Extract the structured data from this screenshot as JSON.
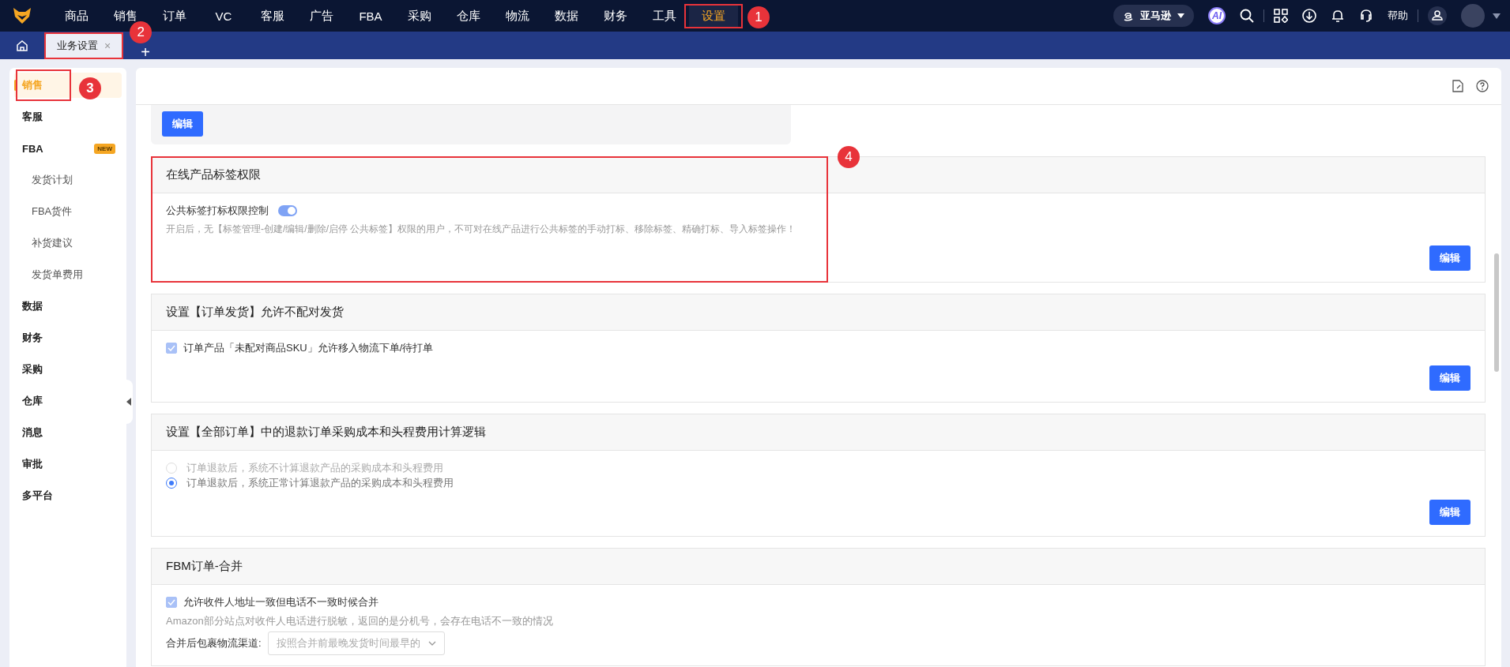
{
  "nav": {
    "items": [
      {
        "label": "商品",
        "selected": false
      },
      {
        "label": "销售",
        "selected": false
      },
      {
        "label": "订单",
        "selected": false
      },
      {
        "label": "VC",
        "selected": false
      },
      {
        "label": "客服",
        "selected": false
      },
      {
        "label": "广告",
        "selected": false
      },
      {
        "label": "FBA",
        "selected": false
      },
      {
        "label": "采购",
        "selected": false
      },
      {
        "label": "仓库",
        "selected": false
      },
      {
        "label": "物流",
        "selected": false
      },
      {
        "label": "数据",
        "selected": false
      },
      {
        "label": "财务",
        "selected": false
      },
      {
        "label": "工具",
        "selected": false
      },
      {
        "label": "设置",
        "selected": true,
        "marker": "1"
      }
    ],
    "marketplace": "亚马逊",
    "ai": "AI",
    "help": "帮助"
  },
  "tabs": {
    "items": [
      {
        "label": "业务设置",
        "close": "×",
        "selected": true,
        "marker": "2"
      }
    ],
    "add": "+"
  },
  "sidebar": {
    "items": [
      {
        "label": "销售",
        "selected": true,
        "marker": "3"
      },
      {
        "label": "客服",
        "selected": false
      },
      {
        "label": "FBA",
        "selected": false,
        "badge": "NEW",
        "children": [
          {
            "label": "发货计划",
            "selected": false
          },
          {
            "label": "FBA货件",
            "selected": false
          },
          {
            "label": "补货建议",
            "selected": false
          },
          {
            "label": "发货单费用",
            "selected": false
          }
        ]
      },
      {
        "label": "数据",
        "selected": false
      },
      {
        "label": "财务",
        "selected": false
      },
      {
        "label": "采购",
        "selected": false
      },
      {
        "label": "仓库",
        "selected": false
      },
      {
        "label": "消息",
        "selected": false
      },
      {
        "label": "审批",
        "selected": false
      },
      {
        "label": "多平台",
        "selected": false
      }
    ]
  },
  "content": {
    "top_button": "编辑",
    "sections": [
      {
        "kind": "toggle",
        "title": "在线产品标签权限",
        "marker": "4",
        "label": "公共标签打标权限控制",
        "on": true,
        "description": "开启后，无【标签管理-创建/编辑/删除/启停 公共标签】权限的用户，不可对在线产品进行公共标签的手动打标、移除标签、精确打标、导入标签操作！",
        "button": "编辑"
      },
      {
        "kind": "checkbox",
        "title": "设置【订单发货】允许不配对发货",
        "label": "订单产品「未配对商品SKU」允许移入物流下单/待打单",
        "checked": true,
        "button": "编辑"
      },
      {
        "kind": "radio",
        "title": "设置【全部订单】中的退款订单采购成本和头程费用计算逻辑",
        "options": [
          {
            "label": "订单退款后，系统不计算退款产品的采购成本和头程费用",
            "selected": false
          },
          {
            "label": "订单退款后，系统正常计算退款产品的采购成本和头程费用",
            "selected": true
          }
        ],
        "button": "编辑"
      },
      {
        "kind": "merge",
        "title": "FBM订单-合并",
        "label": "允许收件人地址一致但电话不一致时候合并",
        "checked": true,
        "note": "Amazon部分站点对收件人电话进行脱敏，返回的是分机号，会存在电话不一致的情况",
        "field_label": "合并后包裹物流渠道:",
        "field_placeholder": "按照合并前最晚发货时间最早的"
      }
    ]
  }
}
